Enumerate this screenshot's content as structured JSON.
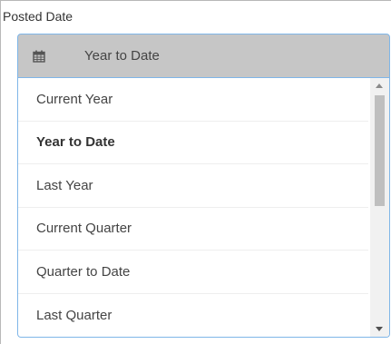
{
  "field": {
    "label": "Posted Date"
  },
  "select": {
    "value": "Year to Date",
    "icon": "calendar-icon"
  },
  "dropdown": {
    "options": [
      {
        "label": "Current Year",
        "selected": false
      },
      {
        "label": "Year to Date",
        "selected": true
      },
      {
        "label": "Last Year",
        "selected": false
      },
      {
        "label": "Current Quarter",
        "selected": false
      },
      {
        "label": "Quarter to Date",
        "selected": false
      },
      {
        "label": "Last Quarter",
        "selected": false
      }
    ]
  },
  "colors": {
    "select_background": "#c6c6c6",
    "focus_border": "#7fb6e8",
    "scroll_thumb": "#bfbfbf"
  }
}
